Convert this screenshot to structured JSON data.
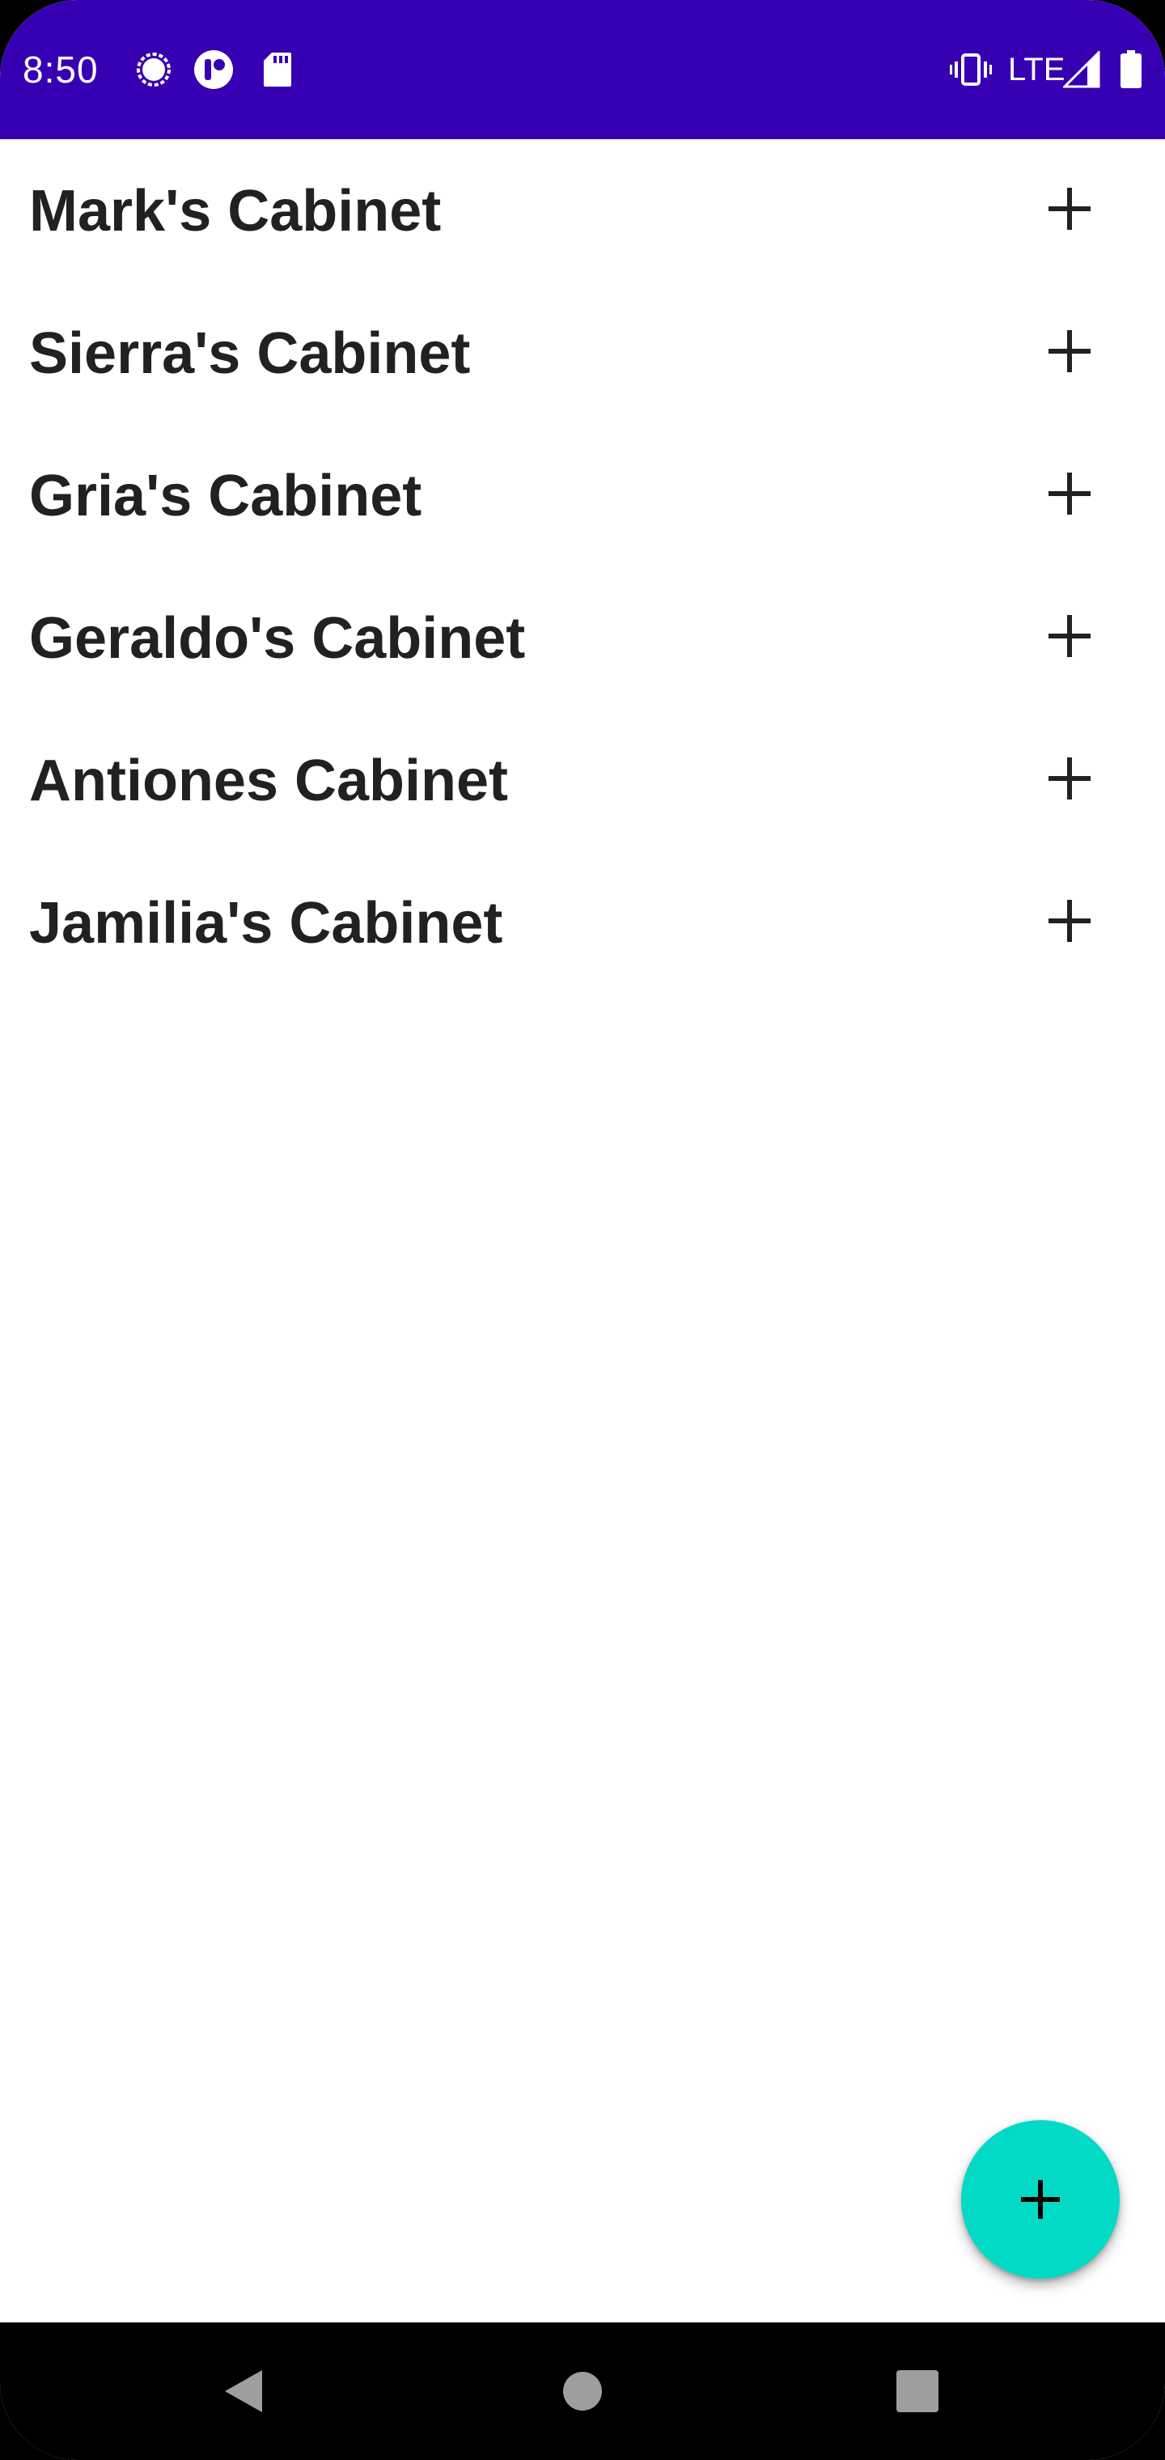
{
  "status_bar": {
    "time": "8:50",
    "network": "LTE",
    "background_color": "#3700b3",
    "icons": [
      "signal-messenger-icon",
      "app-notification-icon",
      "sd-card-icon",
      "vibrate-icon",
      "cell-signal-icon",
      "battery-icon"
    ]
  },
  "cabinets": [
    {
      "label": "Mark's Cabinet",
      "action_icon": "plus-icon"
    },
    {
      "label": "Sierra's Cabinet",
      "action_icon": "plus-icon"
    },
    {
      "label": "Gria's Cabinet",
      "action_icon": "plus-icon"
    },
    {
      "label": "Geraldo's Cabinet",
      "action_icon": "plus-icon"
    },
    {
      "label": "Antiones Cabinet",
      "action_icon": "plus-icon"
    },
    {
      "label": "Jamilia's Cabinet",
      "action_icon": "plus-icon"
    }
  ],
  "fab": {
    "icon": "plus-icon",
    "color": "#03dac5"
  },
  "nav_bar": {
    "buttons": [
      "back-icon",
      "home-icon",
      "recents-icon"
    ]
  }
}
